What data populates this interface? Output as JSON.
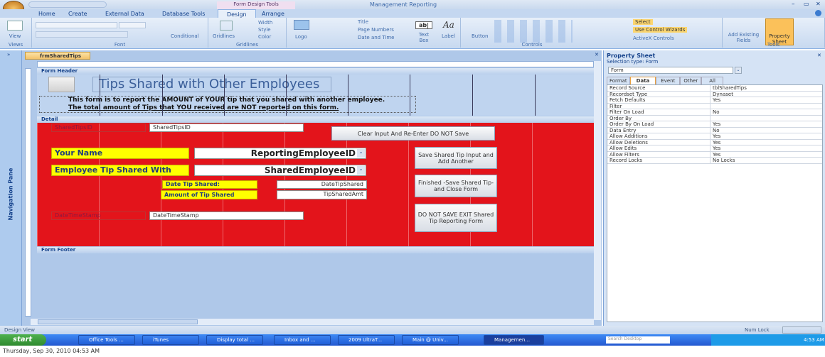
{
  "window": {
    "title": "Management Reporting",
    "context_tab": "Form Design Tools"
  },
  "ribbon_tabs": [
    "Home",
    "Create",
    "External Data",
    "Database Tools",
    "Design",
    "Arrange"
  ],
  "active_tab": "Design",
  "ribbon": {
    "views": {
      "view": "View",
      "label": "Views"
    },
    "font": {
      "conditional": "Conditional",
      "label": "Font"
    },
    "gridlines": {
      "gridlines": "Gridlines",
      "width": "Width",
      "style": "Style",
      "color": "Color",
      "label": "Gridlines"
    },
    "controls": {
      "logo": "Logo",
      "title": "Title",
      "page_numbers": "Page Numbers",
      "date_time": "Date and Time",
      "text_box": "Text Box",
      "label_btn": "Label",
      "button": "Button",
      "select": "Select",
      "wizards": "Use Control Wizards",
      "activex": "ActiveX Controls",
      "label": "Controls"
    },
    "tools": {
      "add_fields": "Add Existing Fields",
      "property_sheet": "Property Sheet",
      "label": "Tools"
    }
  },
  "nav_pane": {
    "label": "Navigation Pane"
  },
  "document": {
    "tab": "frmSharedTips"
  },
  "form": {
    "sections": {
      "header": "Form Header",
      "detail": "Detail",
      "footer": "Form Footer"
    },
    "title": "Tips Shared with Other Employees",
    "desc1": "This form is to report the AMOUNT of YOUR tip that you shared with another employee.",
    "desc2": "The total amount of Tips that YOU received are NOT reported on this form.",
    "shared_tips_id_label": "SharedTipsID",
    "shared_tips_id_field": "SharedTipsID",
    "your_name_label": "Your Name",
    "your_name_combo": "ReportingEmployeeID",
    "shared_with_label": "Employee Tip Shared With",
    "shared_with_combo": "SharedEmployeeID",
    "date_label": "Date Tip Shared:",
    "date_field": "DateTipShared",
    "amount_label": "Amount of Tip Shared",
    "amount_field": "TipSharedAmt",
    "timestamp_label": "DateTimeStamp",
    "timestamp_field": "DateTimeStamp",
    "btn_clear": "Clear Input And Re-Enter DO NOT Save",
    "btn_save": "Save Shared Tip Input and Add Another",
    "btn_finished": "Finished -Save Shared Tip- and Close Form",
    "btn_exit": "DO NOT SAVE EXIT Shared Tip Reporting Form",
    "detail_color": "#e3141b"
  },
  "property_sheet": {
    "title": "Property Sheet",
    "selection_type": "Selection type:  Form",
    "object": "Form",
    "tabs": [
      "Format",
      "Data",
      "Event",
      "Other",
      "All"
    ],
    "active_tab": "Data",
    "rows": [
      {
        "name": "Record Source",
        "value": "tblSharedTips"
      },
      {
        "name": "Recordset Type",
        "value": "Dynaset"
      },
      {
        "name": "Fetch Defaults",
        "value": "Yes"
      },
      {
        "name": "Filter",
        "value": ""
      },
      {
        "name": "Filter On Load",
        "value": "No"
      },
      {
        "name": "Order By",
        "value": ""
      },
      {
        "name": "Order By On Load",
        "value": "Yes"
      },
      {
        "name": "Data Entry",
        "value": "No"
      },
      {
        "name": "Allow Additions",
        "value": "Yes"
      },
      {
        "name": "Allow Deletions",
        "value": "Yes"
      },
      {
        "name": "Allow Edits",
        "value": "Yes"
      },
      {
        "name": "Allow Filters",
        "value": "Yes"
      },
      {
        "name": "Record Locks",
        "value": "No Locks"
      }
    ]
  },
  "status": {
    "left": "Design View",
    "right": "Num Lock"
  },
  "taskbar": {
    "start": "start",
    "items": [
      "Office Tools ...",
      "iTunes",
      "Display total ...",
      "Inbox and ...",
      "2009 UltraT...",
      "Main @ Univ...",
      "Managemen..."
    ],
    "search": "Search Desktop",
    "clock": "4:53 AM"
  },
  "caption": "Thursday, Sep 30, 2010  04:53 AM"
}
